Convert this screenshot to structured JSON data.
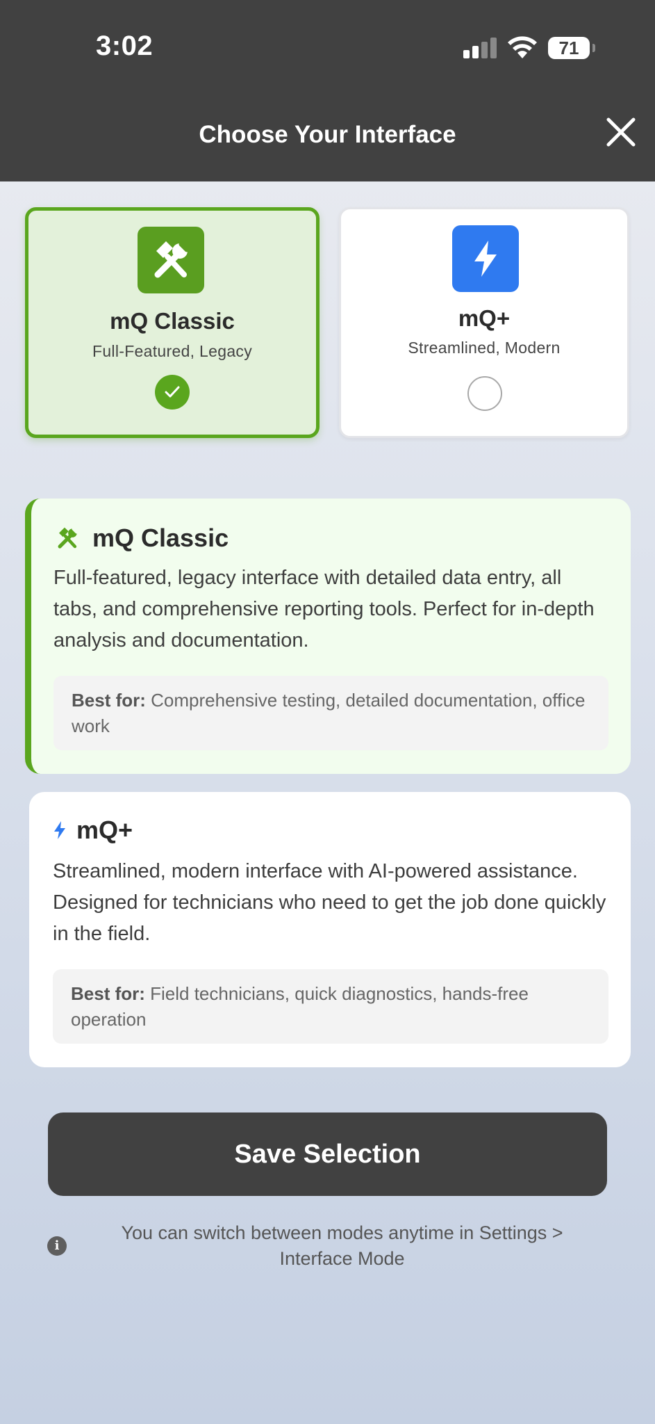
{
  "status_bar": {
    "time": "3:02",
    "battery": "71"
  },
  "header": {
    "title": "Choose Your Interface"
  },
  "options": {
    "classic": {
      "name": "mQ Classic",
      "subtitle": "Full-Featured, Legacy",
      "selected": true,
      "accent": "#5aa61e"
    },
    "plus": {
      "name": "mQ+",
      "subtitle": "Streamlined, Modern",
      "selected": false,
      "accent": "#2f7af0"
    }
  },
  "descriptions": {
    "classic": {
      "title": "mQ Classic",
      "body": "Full-featured, legacy interface with detailed data entry, all tabs, and comprehensive reporting tools. Perfect for in-depth analysis and documentation.",
      "best_label": "Best for:",
      "best_text": " Comprehensive testing, detailed documentation, office work"
    },
    "plus": {
      "title": "mQ+",
      "body": "Streamlined, modern interface with AI-powered assistance. Designed for technicians who need to get the job done quickly in the field.",
      "best_label": "Best for:",
      "best_text": " Field technicians, quick diagnostics, hands-free operation"
    }
  },
  "save_button": {
    "label": "Save Selection"
  },
  "info": {
    "text": "You can switch between modes anytime in Settings > Interface Mode"
  }
}
